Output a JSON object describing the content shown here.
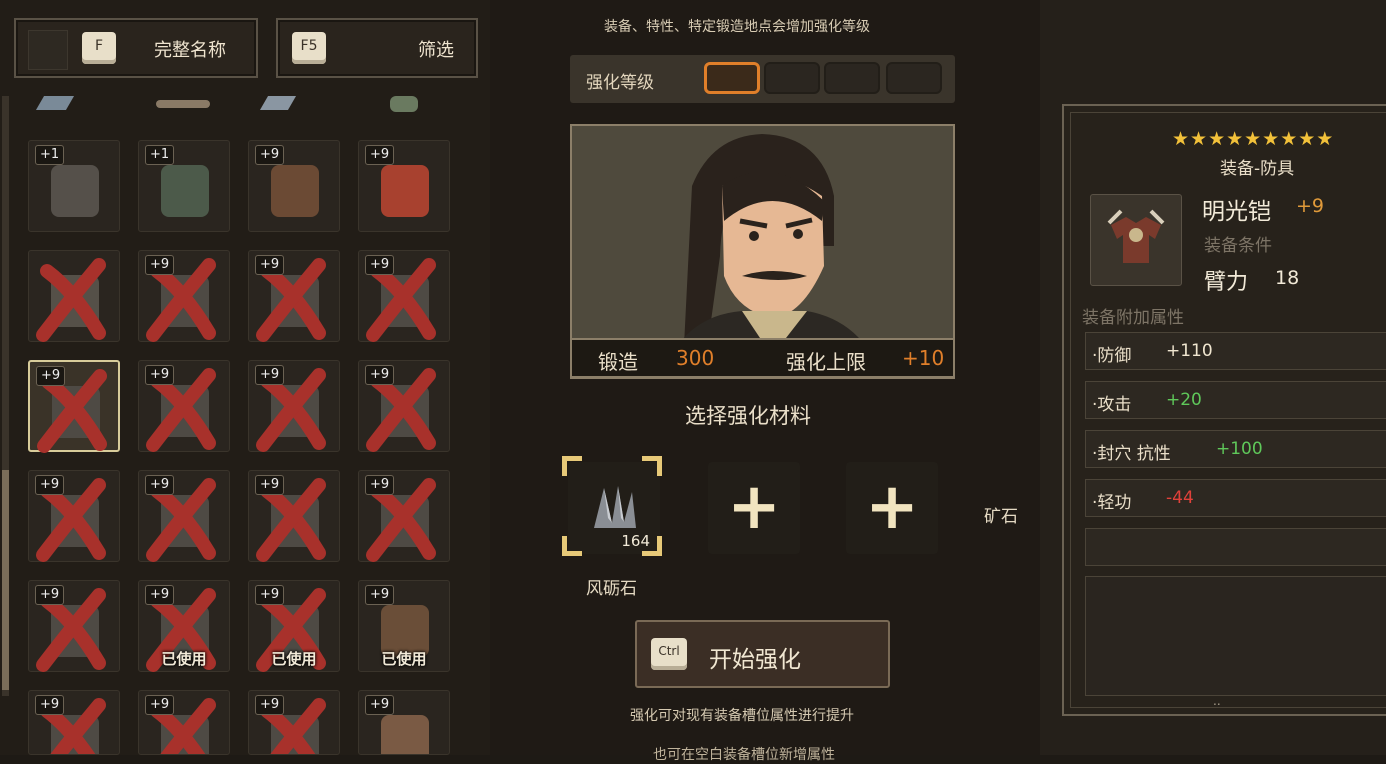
{
  "topbar": {
    "sort_key": "F",
    "sort_label": "完整名称",
    "filter_key": "F5",
    "filter_label": "筛选"
  },
  "inventory": {
    "slots": [
      {
        "level": "+1",
        "crossed": false,
        "used": "",
        "icon": "armor-black-icon",
        "color": "#55504a"
      },
      {
        "level": "+1",
        "crossed": false,
        "used": "",
        "icon": "armor-red-black-icon",
        "color": "#4c5a4a"
      },
      {
        "level": "+9",
        "crossed": false,
        "used": "",
        "icon": "armor-brown-icon",
        "color": "#6b4a34"
      },
      {
        "level": "+9",
        "crossed": false,
        "used": "",
        "icon": "demon-mask-icon",
        "color": "#a8412f"
      },
      {
        "level": "",
        "crossed": true,
        "used": "",
        "icon": "helmet-icon",
        "color": "#555048"
      },
      {
        "level": "+9",
        "crossed": true,
        "used": "",
        "icon": "blade-icon",
        "color": "#4e4a44"
      },
      {
        "level": "+9",
        "crossed": true,
        "used": "",
        "icon": "blade-icon",
        "color": "#4e4a44"
      },
      {
        "level": "+9",
        "crossed": true,
        "used": "",
        "icon": "blade-icon",
        "color": "#4e4a44"
      },
      {
        "level": "+9",
        "crossed": true,
        "used": "",
        "icon": "blade-icon",
        "color": "#4e4a44",
        "selected": true
      },
      {
        "level": "+9",
        "crossed": true,
        "used": "",
        "icon": "blade-icon",
        "color": "#4e4a44"
      },
      {
        "level": "+9",
        "crossed": true,
        "used": "",
        "icon": "blade-icon",
        "color": "#4e4a44"
      },
      {
        "level": "+9",
        "crossed": true,
        "used": "",
        "icon": "blade-icon",
        "color": "#4e4a44"
      },
      {
        "level": "+9",
        "crossed": true,
        "used": "",
        "icon": "blade-icon",
        "color": "#4e4a44"
      },
      {
        "level": "+9",
        "crossed": true,
        "used": "",
        "icon": "blade-icon",
        "color": "#4e4a44"
      },
      {
        "level": "+9",
        "crossed": true,
        "used": "",
        "icon": "blade-icon",
        "color": "#4e4a44"
      },
      {
        "level": "+9",
        "crossed": true,
        "used": "",
        "icon": "blade-icon",
        "color": "#4e4a44"
      },
      {
        "level": "+9",
        "crossed": true,
        "used": "",
        "icon": "blade-icon",
        "color": "#4e4a44"
      },
      {
        "level": "+9",
        "crossed": true,
        "used": "已使用",
        "icon": "blade-icon",
        "color": "#4e4a44"
      },
      {
        "level": "+9",
        "crossed": true,
        "used": "已使用",
        "icon": "blade-icon",
        "color": "#4e4a44"
      },
      {
        "level": "+9",
        "crossed": false,
        "used": "已使用",
        "icon": "owl-armor-icon",
        "color": "#6a4e38"
      },
      {
        "level": "+9",
        "crossed": true,
        "used": "",
        "icon": "blade-icon",
        "color": "#4e4a44"
      },
      {
        "level": "+9",
        "crossed": true,
        "used": "",
        "icon": "blade-icon",
        "color": "#4e4a44"
      },
      {
        "level": "+9",
        "crossed": true,
        "used": "",
        "icon": "blade-icon",
        "color": "#4e4a44"
      },
      {
        "level": "+9",
        "crossed": false,
        "used": "",
        "icon": "sword-icon",
        "color": "#7a5a44"
      }
    ]
  },
  "forge": {
    "hint_top": "装备、特性、特定锻造地点会增加强化等级",
    "level_label": "强化等级",
    "forge_label": "锻造",
    "forge_value": "300",
    "limit_label": "强化上限",
    "limit_value": "+10",
    "select_material": "选择强化材料",
    "material_name": "风砺石",
    "material_count": "164",
    "ore_label": "矿石",
    "start_key": "Ctrl",
    "start_label": "开始强化",
    "hint_bottom": "强化可对现有装备槽位属性进行提升",
    "hint_bottom2": "也可在空白装备槽位新增属性"
  },
  "detail": {
    "stars": "★★★★★★★★★",
    "category": "装备-防具",
    "name": "明光铠",
    "plus": "+9",
    "req_label": "装备条件",
    "req_stat": "臂力",
    "req_value": "18",
    "extra_label": "装备附加属性",
    "attrs": [
      {
        "name": "·防御",
        "value": "+110",
        "color": "#f0e6d0"
      },
      {
        "name": "·攻击",
        "value": "+20",
        "color": "#5fc85a"
      },
      {
        "name": "·封穴 抗性",
        "value": "+100",
        "color": "#5fc85a"
      },
      {
        "name": "·轻功",
        "value": "-44",
        "color": "#e0413a"
      }
    ],
    "dots": ".."
  },
  "colors": {
    "orange": "#e07f2a",
    "cross": "#a8312b",
    "green": "#5fc85a",
    "red": "#e0413a"
  }
}
